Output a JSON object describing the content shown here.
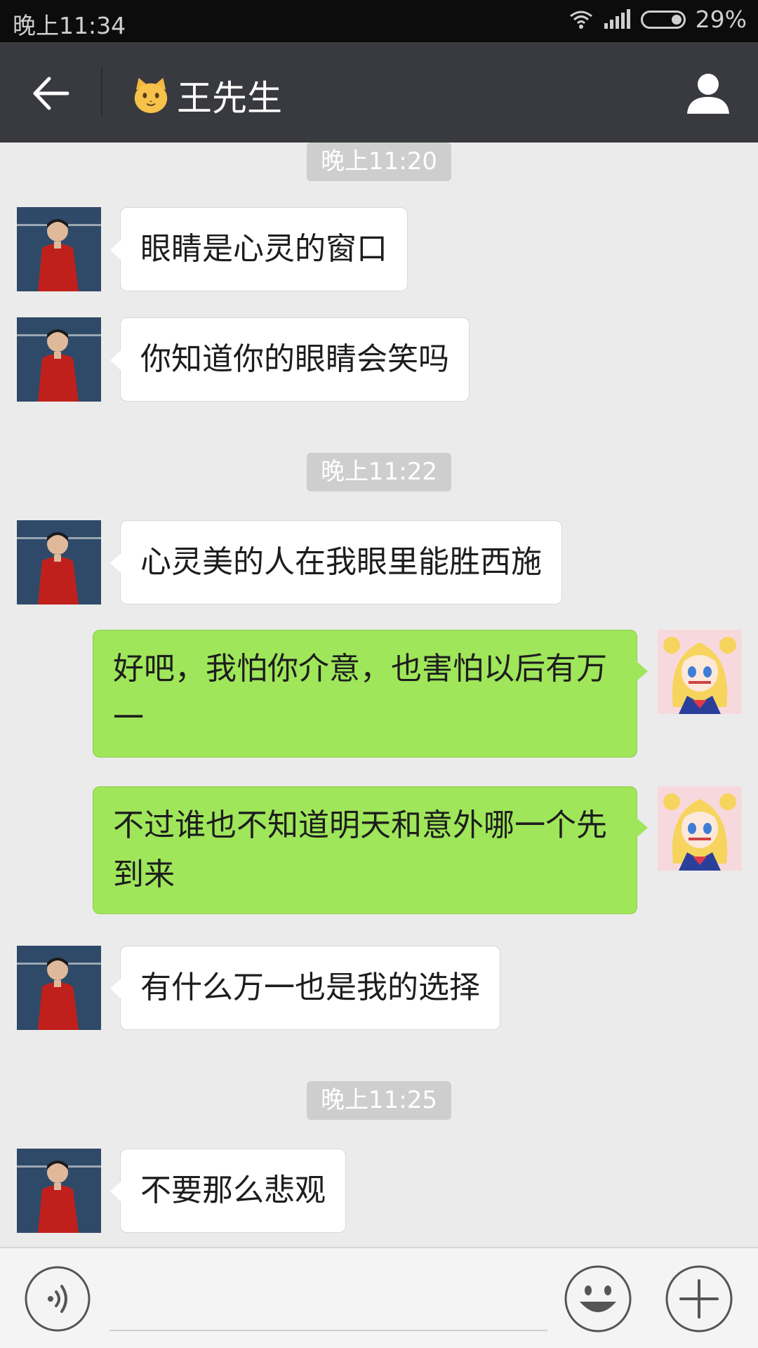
{
  "status_bar": {
    "time": "晚上11:34",
    "battery": "29%",
    "icons": [
      "wifi-icon",
      "signal-icon",
      "battery-icon"
    ]
  },
  "header": {
    "title": "王先生",
    "emoji": "cat-face-icon",
    "back_icon": "back-arrow-icon",
    "profile_icon": "person-icon",
    "background": "#393a3f"
  },
  "messages": [
    {
      "type": "timestamp",
      "text": "晚上11:20"
    },
    {
      "type": "incoming",
      "text": "眼睛是心灵的窗口"
    },
    {
      "type": "incoming",
      "text": "你知道你的眼睛会笑吗"
    },
    {
      "type": "timestamp",
      "text": "晚上11:22"
    },
    {
      "type": "incoming",
      "text": "心灵美的人在我眼里能胜西施"
    },
    {
      "type": "outgoing",
      "text": "好吧，我怕你介意，也害怕以后有万一"
    },
    {
      "type": "outgoing",
      "text": "不过谁也不知道明天和意外哪一个先到来"
    },
    {
      "type": "incoming",
      "text": "有什么万一也是我的选择"
    },
    {
      "type": "timestamp",
      "text": "晚上11:25"
    },
    {
      "type": "incoming",
      "text": "不要那么悲观"
    }
  ],
  "colors": {
    "outgoing_bubble": "#9fe65a",
    "incoming_bubble": "#ffffff",
    "chat_background": "#ebebeb"
  },
  "input_bar": {
    "voice_icon": "voice-icon",
    "emoji_icon": "smiley-icon",
    "plus_icon": "plus-icon",
    "input_value": ""
  }
}
